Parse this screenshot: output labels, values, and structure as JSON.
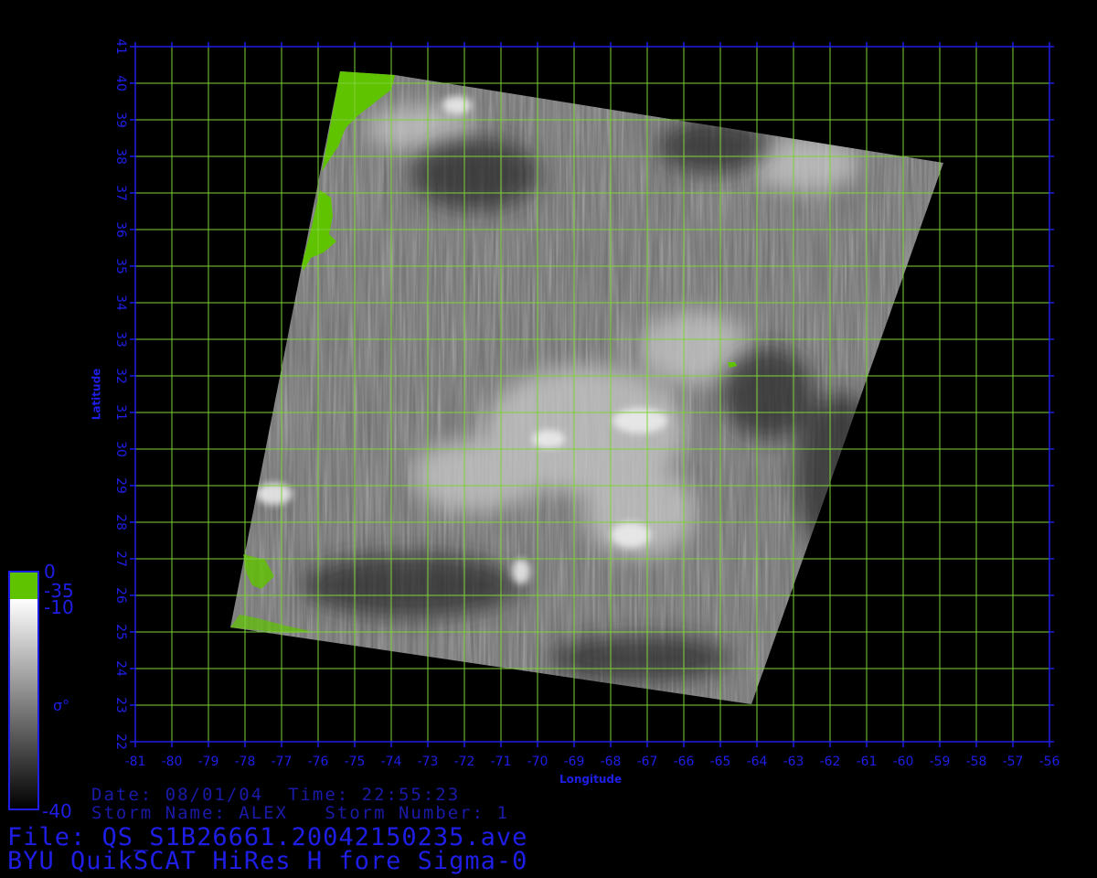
{
  "plot": {
    "lon_range": [
      -81,
      -56
    ],
    "lat_range": [
      22,
      41
    ],
    "lon_ticks": [
      "-81",
      "-80",
      "-79",
      "-78",
      "-77",
      "-76",
      "-75",
      "-74",
      "-73",
      "-72",
      "-71",
      "-70",
      "-69",
      "-68",
      "-67",
      "-66",
      "-65",
      "-64",
      "-63",
      "-62",
      "-61",
      "-60",
      "-59",
      "-58",
      "-57",
      "-56"
    ],
    "lat_ticks": [
      "22",
      "23",
      "24",
      "25",
      "26",
      "27",
      "28",
      "29",
      "30",
      "31",
      "32",
      "33",
      "34",
      "35",
      "36",
      "37",
      "38",
      "39",
      "40",
      "41"
    ],
    "xlabel": "Longitude",
    "ylabel": "Latitude",
    "grid": true,
    "colors": {
      "axis": "#1e1ee6",
      "grid": "#7fd23a",
      "land": "#5fc300"
    }
  },
  "colorbar": {
    "label_top": "0",
    "label_land": "-35",
    "label_mid": "-10",
    "label_bottom": "-40",
    "symbol": "σ°",
    "colors": [
      "#5fc300",
      "#ffffff",
      "#000000"
    ]
  },
  "info": {
    "date_time": "Date: 08/01/04  Time: 22:55:23",
    "storm": "Storm Name: ALEX   Storm Number: 1",
    "file": "File: QS_S1B26661.20042150235.ave",
    "product": "BYU QuikSCAT HiRes H fore Sigma-0"
  }
}
